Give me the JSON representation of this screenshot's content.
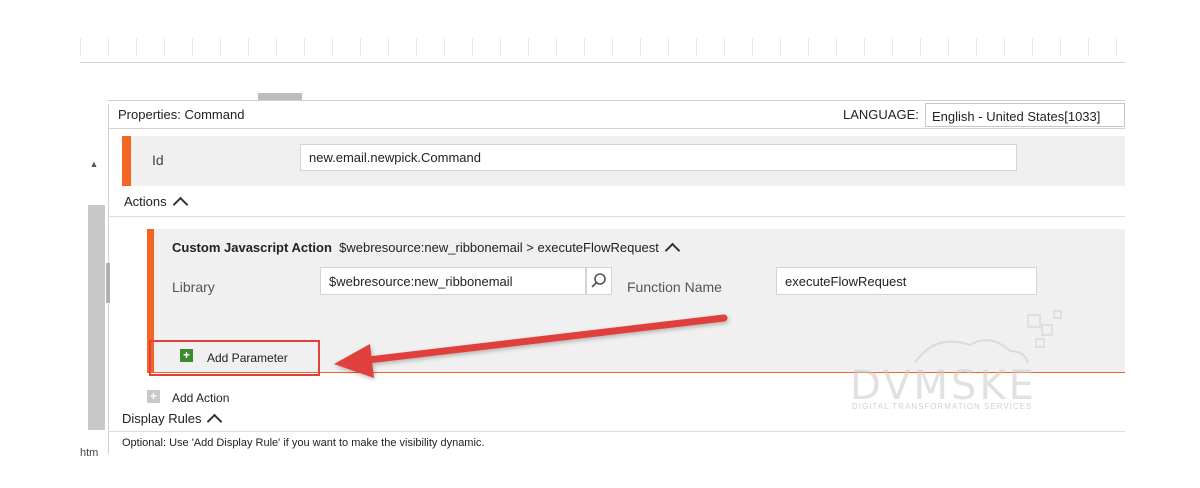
{
  "properties": {
    "title": "Properties: Command",
    "language_label": "LANGUAGE:",
    "language_value": "English - United States[1033]"
  },
  "command": {
    "id_label": "Id",
    "id_value": "new.email.newpick.Command"
  },
  "actions": {
    "label": "Actions",
    "custom_action": {
      "title": "Custom Javascript Action",
      "summary": "$webresource:new_ribbonemail > executeFlowRequest",
      "library_label": "Library",
      "library_value": "$webresource:new_ribbonemail",
      "function_label": "Function Name",
      "function_value": "executeFlowRequest",
      "add_parameter_label": "Add Parameter"
    },
    "add_action_label": "Add Action"
  },
  "display_rules": {
    "label": "Display Rules",
    "optional_text": "Optional: Use 'Add Display Rule' if you want to make the visibility dynamic."
  },
  "left_panel": {
    "tab_label": "htm"
  },
  "watermark": {
    "brand": "DVMSKE",
    "tagline": "DIGITAL TRANSFORMATION SERVICES"
  },
  "colors": {
    "accent": "#f26522",
    "highlight": "#e0413c",
    "add_green": "#3c8a2e"
  }
}
